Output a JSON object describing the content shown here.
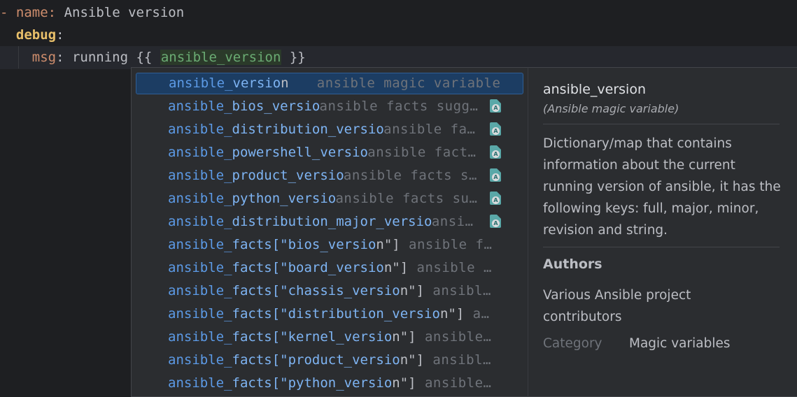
{
  "editor": {
    "line1": {
      "dash": "-",
      "key": "name",
      "colon": ":",
      "value": " Ansible version"
    },
    "line2": {
      "key": "debug",
      "colon": ":"
    },
    "line3": {
      "key": "msg",
      "colon": ":",
      "before": " running {{ ",
      "highlight": "ansible_version",
      "after": " }}"
    }
  },
  "completion": {
    "items": [
      {
        "pre": "ansible_",
        "mid": "versio",
        "post": "n",
        "tail": "",
        "hint": "ansible magic variable",
        "icon": false,
        "selected": true
      },
      {
        "pre": "ansible_",
        "mid": "bios_versio",
        "post": "",
        "tail": "",
        "hint": "ansible facts sugg…",
        "icon": true
      },
      {
        "pre": "ansible_",
        "mid": "distribution_versio",
        "post": "",
        "tail": "",
        "hint": "ansible fa…",
        "icon": true
      },
      {
        "pre": "ansible_",
        "mid": "powershell_versio",
        "post": "",
        "tail": "",
        "hint": "ansible fact…",
        "icon": true
      },
      {
        "pre": "ansible_",
        "mid": "product_versio",
        "post": "",
        "tail": "",
        "hint": "ansible facts s…",
        "icon": true
      },
      {
        "pre": "ansible_",
        "mid": "python_versio",
        "post": "",
        "tail": "",
        "hint": "ansible facts su…",
        "icon": true
      },
      {
        "pre": "ansible_",
        "mid": "distribution_major_versio",
        "post": "",
        "tail": "",
        "hint": "ansi…",
        "icon": true
      },
      {
        "pre": "ansible_",
        "mid": "facts[\"bios_versio",
        "post": "n\"]",
        "tail": "",
        "hint": "ansible f…",
        "icon": false
      },
      {
        "pre": "ansible_",
        "mid": "facts[\"board_versio",
        "post": "n\"]",
        "tail": "",
        "hint": "ansible …",
        "icon": false
      },
      {
        "pre": "ansible_",
        "mid": "facts[\"chassis_versio",
        "post": "n\"]",
        "tail": "",
        "hint": "ansibl…",
        "icon": false
      },
      {
        "pre": "ansible_",
        "mid": "facts[\"distribution_versio",
        "post": "n\"]",
        "tail": "",
        "hint": "a…",
        "icon": false
      },
      {
        "pre": "ansible_",
        "mid": "facts[\"kernel_versio",
        "post": "n\"]",
        "tail": "",
        "hint": "ansible…",
        "icon": false
      },
      {
        "pre": "ansible_",
        "mid": "facts[\"product_versio",
        "post": "n\"]",
        "tail": "",
        "hint": "ansibl…",
        "icon": false
      },
      {
        "pre": "ansible_",
        "mid": "facts[\"python_versio",
        "post": "n\"]",
        "tail": "",
        "hint": "ansible…",
        "icon": false
      }
    ],
    "icon_name": "ansible-facts-file-icon",
    "icon_glyph": "A"
  },
  "doc": {
    "title": "ansible_version",
    "subtitle": "(Ansible magic variable)",
    "description": "Dictionary/map that contains information about the current running version of ansible, it has the following keys: full, major, minor, revision and string.",
    "authors_heading": "Authors",
    "authors": "Various Ansible project contributors",
    "category_label": "Category",
    "category_value": "Magic variables"
  },
  "colors": {
    "background": "#1e1f22",
    "popup": "#2b2d30",
    "selection": "#1c3d63",
    "match": "#5c9ae6",
    "key": "#cf8e6d"
  }
}
